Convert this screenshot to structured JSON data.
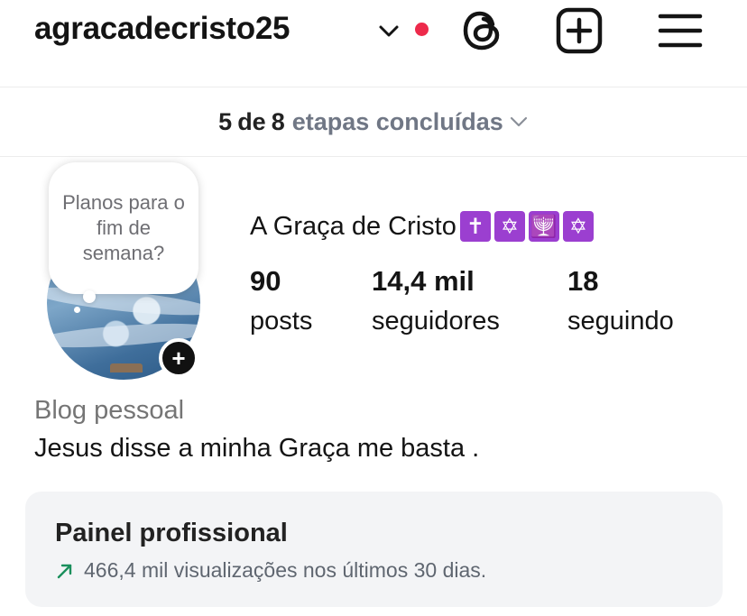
{
  "header": {
    "username": "agracadecristo25",
    "notification_color": "#ed2a4b",
    "icons": [
      "chevron-down-icon",
      "threads-icon",
      "add-post-icon",
      "menu-icon"
    ]
  },
  "steps": {
    "done": "5",
    "connector": "de",
    "total": "8",
    "text": "etapas concluídas"
  },
  "profile": {
    "note_bubble": "Planos para o fim de semana?",
    "display_name": "A Graça de Cristo",
    "name_symbols": [
      "✝",
      "✡",
      "🕎",
      "✡"
    ],
    "stats": {
      "posts_value": "90",
      "posts_label": "posts",
      "followers_value": "14,4 mil",
      "followers_label": "seguidores",
      "following_value": "18",
      "following_label": "seguindo"
    },
    "category": "Blog pessoal",
    "bio": "Jesus disse a minha Graça me basta ."
  },
  "dashboard": {
    "title": "Painel profissional",
    "subtitle": "466,4 mil visualizações nos últimos 30 dias.",
    "trend_color": "#1a8f5c"
  }
}
